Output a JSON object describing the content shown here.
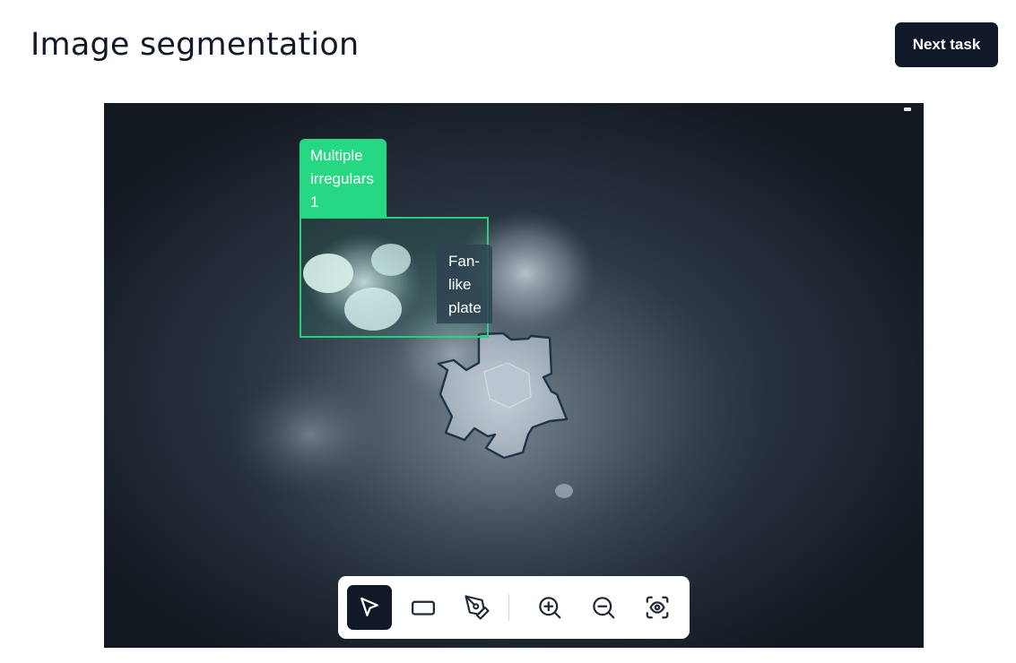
{
  "header": {
    "title": "Image segmentation",
    "next_label": "Next task"
  },
  "annotations": {
    "box_label": "Multiple\nirregulars\n1",
    "polygon_label": "Fan-\nlike\nplate",
    "colors": {
      "box": "#27d882",
      "polygon": "#2d4450"
    }
  },
  "toolbar": {
    "tools": [
      {
        "name": "select",
        "icon": "cursor-arrow-icon",
        "active": true
      },
      {
        "name": "rectangle",
        "icon": "rectangle-icon",
        "active": false
      },
      {
        "name": "polygon-pen",
        "icon": "pen-nib-icon",
        "active": false
      },
      {
        "name": "zoom-in",
        "icon": "zoom-in-icon",
        "active": false
      },
      {
        "name": "zoom-out",
        "icon": "zoom-out-icon",
        "active": false
      },
      {
        "name": "toggle-visibility",
        "icon": "eye-frame-icon",
        "active": false
      }
    ]
  }
}
